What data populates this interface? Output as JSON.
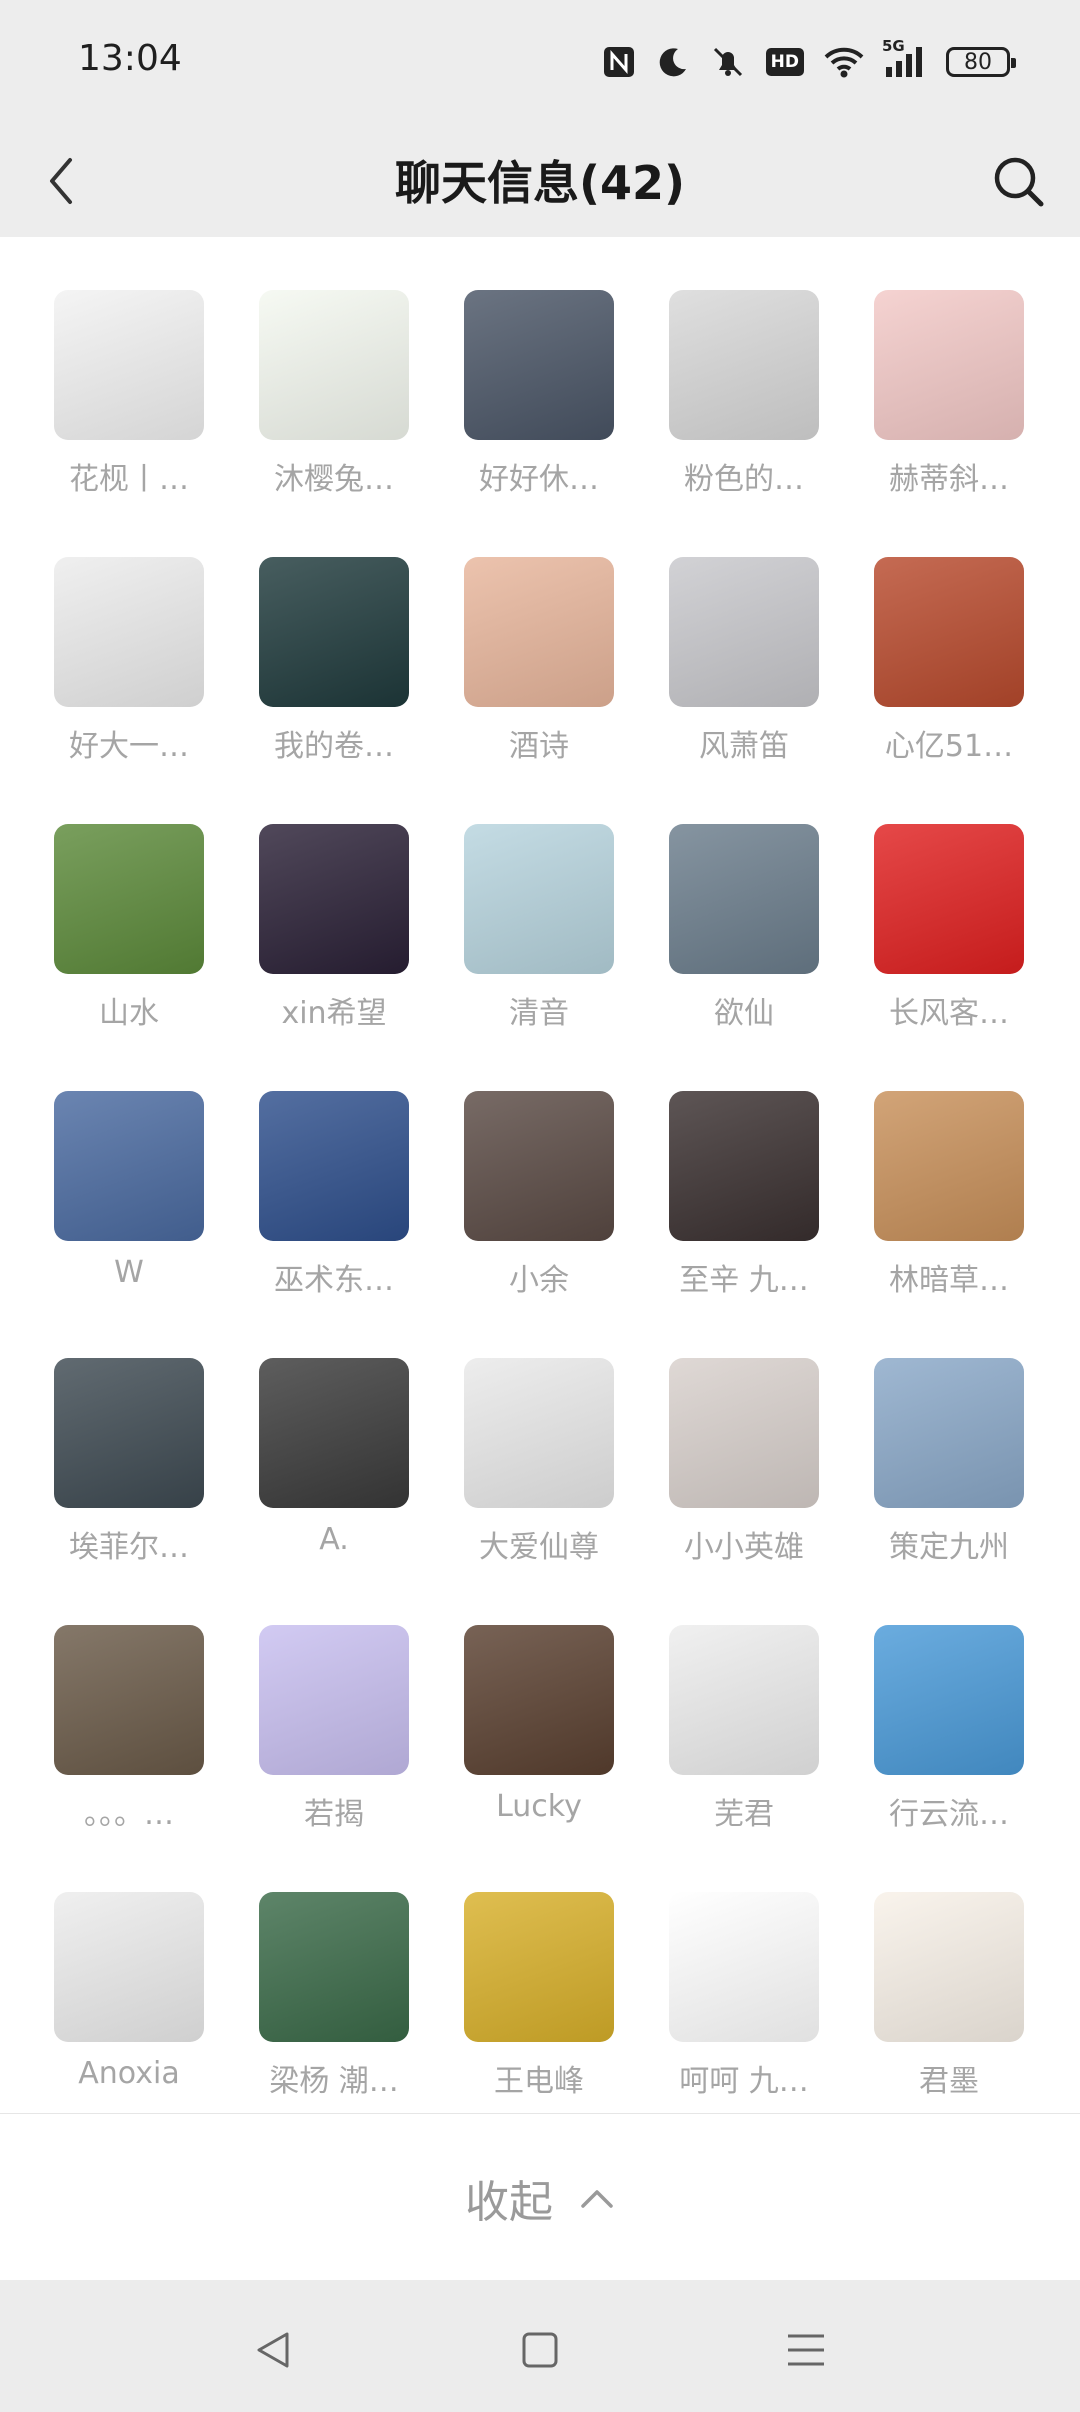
{
  "status_bar": {
    "time": "13:04",
    "icons": [
      "nfc-icon",
      "moon-icon",
      "bell-off-icon",
      "hd-icon",
      "wifi-icon",
      "5g-signal-icon",
      "battery-icon"
    ],
    "hd_text": "HD",
    "network_text": "5G",
    "battery": "80"
  },
  "header": {
    "title": "聊天信息(42)",
    "back_icon": "chevron-left-icon",
    "search_icon": "search-icon"
  },
  "members": [
    {
      "name": "花枧丨…",
      "color": "#f2f2f2"
    },
    {
      "name": "沐樱兔…",
      "color": "#f4f8f0"
    },
    {
      "name": "好好休…",
      "color": "#4a5566"
    },
    {
      "name": "粉色的…",
      "color": "#d8d8d8"
    },
    {
      "name": "赫蒂斜…",
      "color": "#f3c9c7"
    },
    {
      "name": "好大一…",
      "color": "#ececec"
    },
    {
      "name": "我的卷…",
      "color": "#1f3a3c"
    },
    {
      "name": "酒诗",
      "color": "#e8b69c"
    },
    {
      "name": "风萧笛",
      "color": "#c8c8cc"
    },
    {
      "name": "心亿51…",
      "color": "#b84a2d"
    },
    {
      "name": "山水",
      "color": "#5c8a3a"
    },
    {
      "name": "xin希望",
      "color": "#2a2036"
    },
    {
      "name": "清音",
      "color": "#b7d4de"
    },
    {
      "name": "欲仙",
      "color": "#6b7d8c"
    },
    {
      "name": "长风客…",
      "color": "#e02020"
    },
    {
      "name": "W",
      "color": "#4a6aa0"
    },
    {
      "name": "巫术东…",
      "color": "#2e4f8c"
    },
    {
      "name": "小余",
      "color": "#5a4a44"
    },
    {
      "name": "至辛 九…",
      "color": "#3a3030"
    },
    {
      "name": "林暗草…",
      "color": "#c8905a"
    },
    {
      "name": "埃菲尔…",
      "color": "#3e4a52"
    },
    {
      "name": "A.",
      "color": "#3a3a3a"
    },
    {
      "name": "大爱仙尊",
      "color": "#e9e9e9"
    },
    {
      "name": "小小英雄",
      "color": "#d8d0cc"
    },
    {
      "name": "策定九州",
      "color": "#8aa8c8"
    },
    {
      "name": "。。。…",
      "color": "#6a5a48"
    },
    {
      "name": "若揭",
      "color": "#c8bff0"
    },
    {
      "name": "Lucky",
      "color": "#5a4030"
    },
    {
      "name": "芜君",
      "color": "#ededed"
    },
    {
      "name": "行云流…",
      "color": "#4a9ad8"
    },
    {
      "name": "Anoxia",
      "color": "#ececec"
    },
    {
      "name": "梁杨 潮…",
      "color": "#3a6a48"
    },
    {
      "name": "王电峰",
      "color": "#d8b02a"
    },
    {
      "name": "呵呵 九…",
      "color": "#ffffff"
    },
    {
      "name": "君墨",
      "color": "#f8f1e8"
    },
    {
      "name": "",
      "color": "#3a2a1a"
    },
    {
      "name": "",
      "color": "#f6c8c8"
    },
    {
      "name": "",
      "color": "#8a6a6a"
    },
    {
      "name": "",
      "color": "#6a6a6a"
    },
    {
      "name": "",
      "color": "#f4f4f4"
    }
  ],
  "footer": {
    "collapse_label": "收起",
    "collapse_icon": "chevron-up-icon"
  },
  "system_nav": {
    "back_icon": "triangle-back-icon",
    "home_icon": "square-home-icon",
    "menu_icon": "menu-lines-icon"
  }
}
